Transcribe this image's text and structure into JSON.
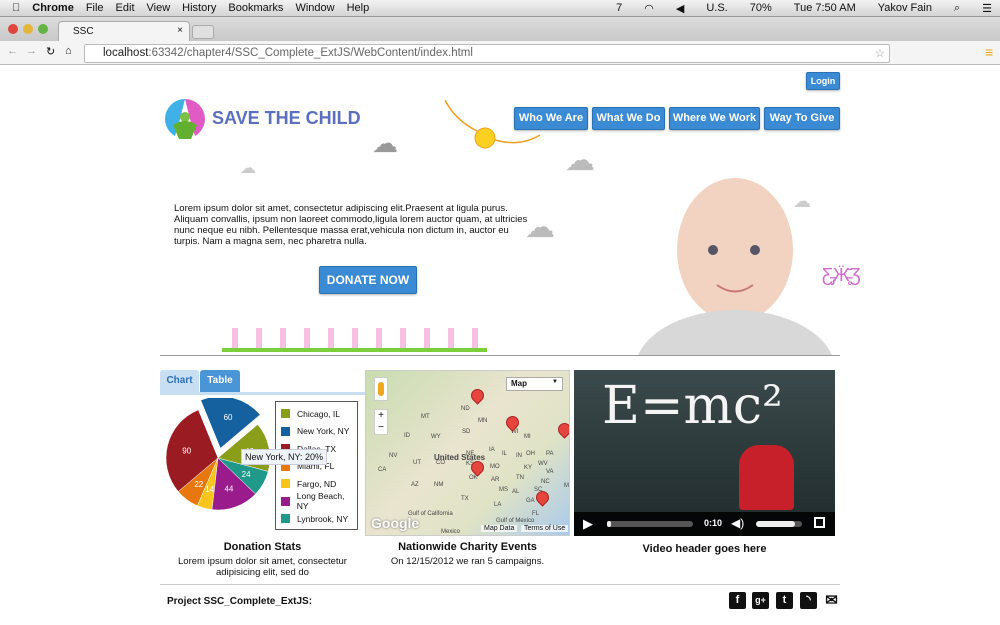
{
  "menubar": {
    "app": "Chrome",
    "items": [
      "File",
      "Edit",
      "View",
      "History",
      "Bookmarks",
      "Window",
      "Help"
    ],
    "status": {
      "battery": "70%",
      "locale": "U.S.",
      "time": "Tue 7:50 AM",
      "user": "Yakov Fain",
      "badge": "7"
    }
  },
  "browser": {
    "tab_title": "SSC",
    "url_host": "localhost",
    "url_path": ":63342/chapter4/SSC_Complete_ExtJS/WebContent/index.html"
  },
  "header": {
    "login": "Login",
    "logo_text": "SAVE THE CHILD",
    "nav": [
      "Who We Are",
      "What We Do",
      "Where We Work",
      "Way To Give"
    ]
  },
  "hero": {
    "text": "Lorem ipsum dolor sit amet, consectetur adipiscing elit.Praesent at ligula purus. Aliquam convallis, ipsum non laoreet commodo,ligula lorem auctor quam, at ultricies nunc neque eu nibh. Pellentesque massa erat,vehicula non dictum in, auctor eu turpis. Nam a magna sem, nec pharetra nulla.",
    "donate": "DONATE NOW"
  },
  "stats": {
    "tabs": [
      "Chart",
      "Table"
    ],
    "active_tab": "Chart",
    "title": "Donation Stats",
    "text": "Lorem ipsum dolor sit amet, consectetur adipisicing elit, sed do",
    "tooltip": "New York, NY: 20%"
  },
  "chart_data": {
    "type": "pie",
    "categories": [
      "Chicago, IL",
      "New York, NY",
      "Dallas, TX",
      "Miami, FL",
      "Fargo, ND",
      "Long Beach, NY",
      "Lynbrook, NY"
    ],
    "values": [
      46,
      60,
      90,
      22,
      14,
      44,
      24
    ],
    "colors": [
      "#8a9e1a",
      "#15609e",
      "#9b1b22",
      "#e8780e",
      "#f7c51c",
      "#9a1c8c",
      "#20998a"
    ],
    "exploded": "New York, NY",
    "legend": "right"
  },
  "map": {
    "type_select": "Map",
    "labels": [
      "ND",
      "MN",
      "MT",
      "SD",
      "WY",
      "ID",
      "NE",
      "IA",
      "WI",
      "MI",
      "United States",
      "NV",
      "UT",
      "CO",
      "IL",
      "IN",
      "OH",
      "PA",
      "CA",
      "KS",
      "MO",
      "KY",
      "WV",
      "VA",
      "AZ",
      "NM",
      "OK",
      "TN",
      "NC",
      "AR",
      "MS",
      "AL",
      "SC",
      "TX",
      "GA",
      "LA",
      "FL",
      "MD",
      "Gulf of California",
      "Gulf of Mexico",
      "Mexico"
    ],
    "markers": 5,
    "map_data": "Map Data",
    "terms": "Terms of Use",
    "google": "Google",
    "title": "Nationwide Charity Events",
    "text": "On 12/15/2012 we ran 5 campaigns."
  },
  "video": {
    "board_text": "E=mc²",
    "time": "0:10",
    "progress": 0.05,
    "volume": 0.85,
    "title": "Video header goes here"
  },
  "footer": {
    "text": "Project SSC_Complete_ExtJS:",
    "social": [
      "facebook",
      "google-plus",
      "twitter",
      "rss",
      "email"
    ]
  }
}
